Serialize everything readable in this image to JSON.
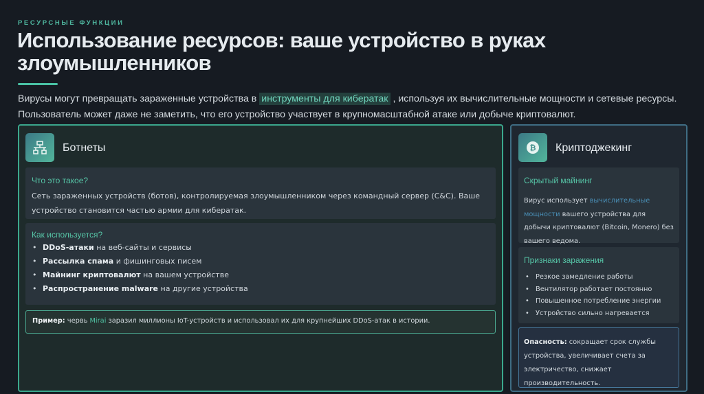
{
  "header": {
    "eyebrow": "РЕСУРСНЫЕ ФУНКЦИИ",
    "title": "Использование ресурсов: ваше устройство в руках злоумышленников",
    "intro_before": "Вирусы могут превращать зараженные устройства в ",
    "intro_highlight": "инструменты для кибератак",
    "intro_after": " , используя их вычислительные мощности и сетевые ресурсы. Пользователь может даже не заметить, что его устройство участвует в крупномасштабной атаке или добыче криптовалют."
  },
  "botnets": {
    "icon": "network-icon",
    "title": "Ботнеты",
    "what": {
      "heading": "Что это такое?",
      "text": "Сеть зараженных устройств (ботов), контролируемая злоумышленником через командный сервер (C&C). Ваше устройство становится частью армии для кибератак."
    },
    "how": {
      "heading": "Как используется?",
      "items": [
        {
          "bold": "DDoS-атаки",
          "rest": " на веб-сайты и сервисы"
        },
        {
          "bold": "Рассылка спама",
          "rest": " и фишинговых писем"
        },
        {
          "bold": "Майнинг криптовалют",
          "rest": " на вашем устройстве"
        },
        {
          "bold": "Распространение malware",
          "rest": " на другие устройства"
        }
      ]
    },
    "example": {
      "label": "Пример:",
      "before": " червь ",
      "highlight": "Mirai",
      "after": " заразил миллионы IoT-устройств и использовал их для крупнейших DDoS-атак в истории."
    }
  },
  "cryptojacking": {
    "icon": "bitcoin-icon",
    "title": "Криптоджекинг",
    "hidden": {
      "heading": "Скрытый майнинг",
      "before": "Вирус использует ",
      "highlight": "вычислительные мощности",
      "after": " вашего устройства для добычи криптовалют (Bitcoin, Monero) без вашего ведома."
    },
    "signs": {
      "heading": "Признаки заражения",
      "items": [
        "Резкое замедление работы",
        "Вентилятор работает постоянно",
        "Повышенное потребление энергии",
        "Устройство сильно нагревается"
      ]
    },
    "danger": {
      "label": "Опасность:",
      "text": " сокращает срок службы устройства, увеличивает счета за электричество, снижает производительность."
    }
  },
  "colors": {
    "accent": "#49c2a5",
    "background": "#161b22",
    "left_border": "#3ba78d",
    "right_border": "#3f6d84"
  }
}
